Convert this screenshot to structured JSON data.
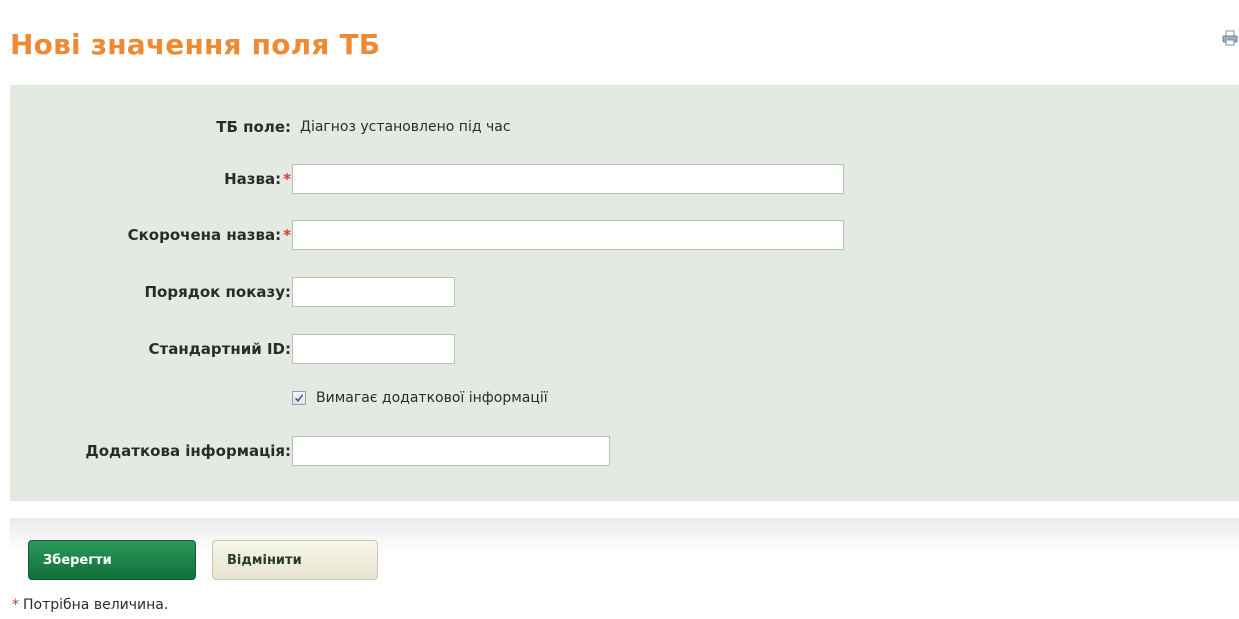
{
  "page": {
    "title": "Нові значення поля ТБ"
  },
  "icons": {
    "print": "print-icon",
    "checkbox": "checkbox-checked-icon"
  },
  "form": {
    "tb_field": {
      "label": "ТБ поле:",
      "value": "Діагноз установлено під час"
    },
    "name": {
      "label": "Назва:",
      "required_mark": "*",
      "value": ""
    },
    "short_name": {
      "label": "Скорочена назва:",
      "required_mark": "*",
      "value": ""
    },
    "display_order": {
      "label": "Порядок показу:",
      "value": ""
    },
    "standard_id": {
      "label": "Стандартний ID:",
      "value": ""
    },
    "requires_info": {
      "label": "Вимагає додаткової інформації",
      "checked": true
    },
    "additional_info": {
      "label": "Додаткова інформація:",
      "value": ""
    }
  },
  "buttons": {
    "save_label": "Зберегти",
    "cancel_label": "Відмінити"
  },
  "footer": {
    "required_mark": "*",
    "required_note": "Потрібна величина."
  },
  "colors": {
    "title": "#ee8a33",
    "panel_background": "#e4e9e2",
    "required": "#d63a2a",
    "save_button": "#1f8448",
    "cancel_button": "#efeedd"
  }
}
